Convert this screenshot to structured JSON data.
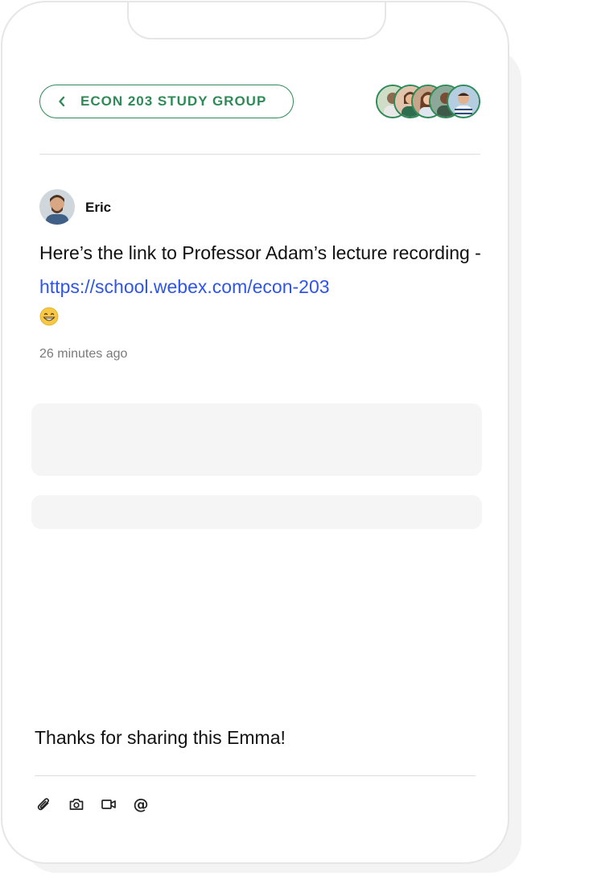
{
  "header": {
    "group_title": "ECON 203 STUDY GROUP",
    "back_icon": "chevron-left-icon",
    "accent_color": "#2e8b57"
  },
  "members": [
    {
      "name": "member-1",
      "bg": "#c9d6c0"
    },
    {
      "name": "member-2",
      "bg": "#d8b49a"
    },
    {
      "name": "member-3",
      "bg": "#b88a6a"
    },
    {
      "name": "member-4",
      "bg": "#7e9a8c"
    },
    {
      "name": "member-5",
      "bg": "#a9c2d6"
    }
  ],
  "post": {
    "author": "Eric",
    "text_prefix": "Here’s the link to Professor Adam’s lecture recording - ",
    "link_text": "https://school.webex.com/econ-203",
    "emoji": "grinning-face-icon",
    "timestamp": "26 minutes ago",
    "link_color": "#2f55e8"
  },
  "composer": {
    "value": "Thanks for sharing this Emma!",
    "tools": {
      "attach": "paperclip-icon",
      "camera": "camera-icon",
      "video": "video-icon",
      "mention_label": "@"
    }
  }
}
